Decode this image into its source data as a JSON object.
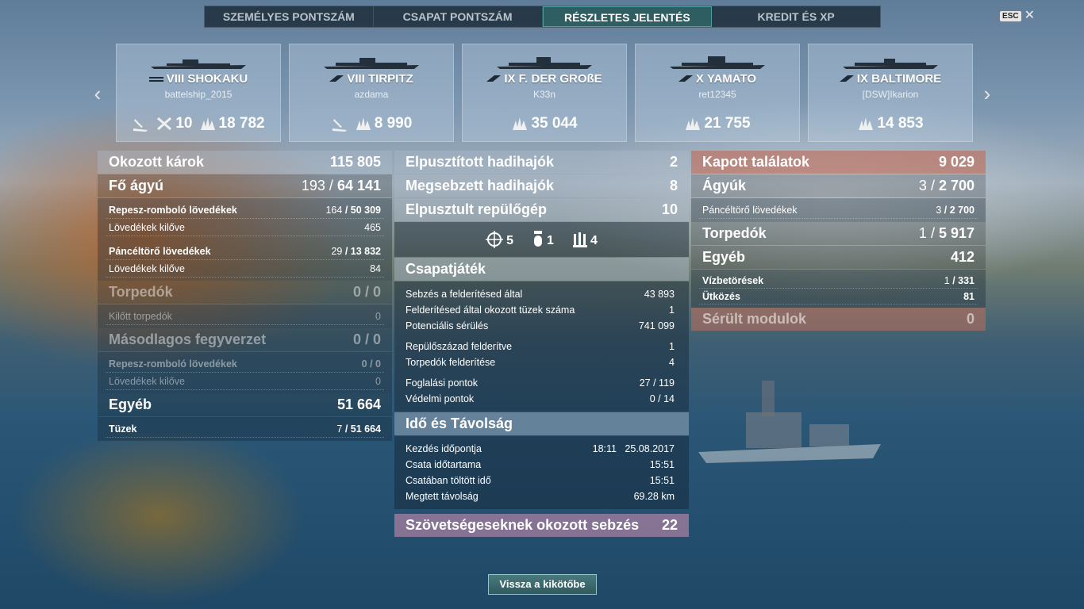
{
  "tabs": [
    "SZEMÉLYES PONTSZÁM",
    "CSAPAT PONTSZÁM",
    "RÉSZLETES JELENTÉS",
    "KREDIT ÉS XP"
  ],
  "active_tab_index": 2,
  "esc_label": "ESC",
  "ships": [
    {
      "tier_name": "VIII SHOKAKU",
      "player": "battelship_2015",
      "stats": [
        {
          "icon": "aircraft-carrier-hit-icon",
          "value": ""
        },
        {
          "icon": "planes-destroyed-icon",
          "value": "10"
        },
        {
          "icon": "damage-icon",
          "value": "18 782"
        }
      ]
    },
    {
      "tier_name": "VIII TIRPITZ",
      "player": "azdama",
      "stats": [
        {
          "icon": "torpedo-hit-icon",
          "value": ""
        },
        {
          "icon": "damage-icon",
          "value": "8 990"
        }
      ]
    },
    {
      "tier_name": "IX F. DER GROßE",
      "player": "K33n",
      "stats": [
        {
          "icon": "damage-icon",
          "value": "35 044"
        }
      ]
    },
    {
      "tier_name": "X YAMATO",
      "player": "ret12345",
      "stats": [
        {
          "icon": "damage-icon",
          "value": "21 755"
        }
      ]
    },
    {
      "tier_name": "IX BALTIMORE",
      "player": "[DSW]Ikarion",
      "stats": [
        {
          "icon": "damage-icon",
          "value": "14 853"
        }
      ]
    }
  ],
  "left": {
    "damage_dealt": {
      "label": "Okozott károk",
      "value": "115 805"
    },
    "main_battery": {
      "label": "Fő ágyú",
      "hits": "193",
      "total": "64 141"
    },
    "he_shells": {
      "label": "Repesz-romboló lövedékek",
      "hits": "164",
      "total": "50 309"
    },
    "he_fired": {
      "label": "Lövedékek kilőve",
      "value": "465"
    },
    "ap_shells": {
      "label": "Páncéltörő lövedékek",
      "hits": "29",
      "total": "13 832"
    },
    "ap_fired": {
      "label": "Lövedékek kilőve",
      "value": "84"
    },
    "torpedoes": {
      "label": "Torpedók",
      "hits": "0",
      "total": "0"
    },
    "torps_fired": {
      "label": "Kilőtt torpedók",
      "value": "0"
    },
    "secondary": {
      "label": "Másodlagos fegyverzet",
      "hits": "0",
      "total": "0"
    },
    "sec_he": {
      "label": "Repesz-romboló lövedékek",
      "hits": "0",
      "total": "0"
    },
    "sec_fired": {
      "label": "Lövedékek kilőve",
      "value": "0"
    },
    "other": {
      "label": "Egyéb",
      "value": "51 664"
    },
    "fires": {
      "label": "Tüzek",
      "hits": "7",
      "total": "51 664"
    }
  },
  "mid": {
    "ships_destroyed": {
      "label": "Elpusztított hadihajók",
      "value": "2"
    },
    "ships_damaged": {
      "label": "Megsebzett hadihajók",
      "value": "8"
    },
    "planes_destroyed": {
      "label": "Elpusztult repülőgép",
      "value": "10"
    },
    "icon_counts": [
      {
        "icon": "citadel-icon",
        "value": "5"
      },
      {
        "icon": "torpedo-icon",
        "value": "1"
      },
      {
        "icon": "shells-icon",
        "value": "4"
      }
    ],
    "teamplay_title": "Csapatjáték",
    "teamplay": [
      {
        "label": "Sebzés a felderítésed által",
        "value": "43 893"
      },
      {
        "label": "Felderítésed által okozott tüzek száma",
        "value": "1"
      },
      {
        "label": "Potenciális sérülés",
        "value": "741 099"
      },
      {
        "label": "Repülőszázad felderítve",
        "value": "1"
      },
      {
        "label": "Torpedók felderítése",
        "value": "4"
      },
      {
        "label": "Foglalási pontok",
        "value": "27 / 119"
      },
      {
        "label": "Védelmi pontok",
        "value": "0 / 14"
      }
    ],
    "time_title": "Idő és Távolság",
    "time": [
      {
        "label": "Kezdés időpontja",
        "value": "18:11   25.08.2017"
      },
      {
        "label": "Csata időtartama",
        "value": "15:51"
      },
      {
        "label": "Csatában töltött idő",
        "value": "15:51"
      },
      {
        "label": "Megtett távolság",
        "value": "69.28 km"
      }
    ],
    "ally_damage": {
      "label": "Szövetségeseknek okozott sebzés",
      "value": "22"
    }
  },
  "right": {
    "hits_taken": {
      "label": "Kapott találatok",
      "value": "9 029"
    },
    "guns": {
      "label": "Ágyúk",
      "hits": "3",
      "total": "2 700"
    },
    "ap": {
      "label": "Páncéltörő lövedékek",
      "hits": "3",
      "total": "2 700"
    },
    "torps": {
      "label": "Torpedók",
      "hits": "1",
      "total": "5 917"
    },
    "other": {
      "label": "Egyéb",
      "value": "412"
    },
    "flooding": {
      "label": "Vízbetörések",
      "hits": "1",
      "total": "331"
    },
    "ramming": {
      "label": "Ütközés",
      "value": "81"
    },
    "modules": {
      "label": "Sérült modulok",
      "value": "0"
    }
  },
  "back_button": "Vissza a kikötőbe"
}
